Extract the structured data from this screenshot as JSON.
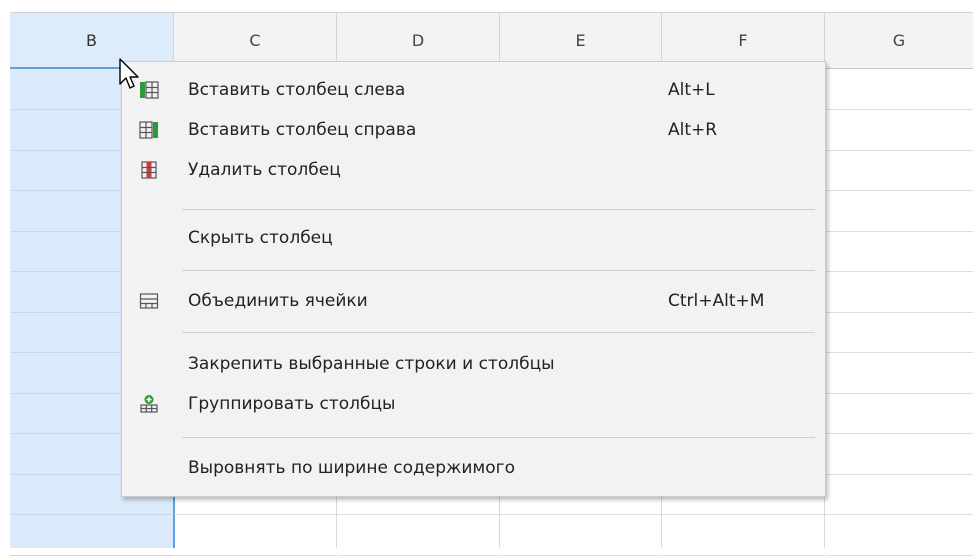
{
  "columns": [
    {
      "letter": "B",
      "selected": true
    },
    {
      "letter": "C",
      "selected": false
    },
    {
      "letter": "D",
      "selected": false
    },
    {
      "letter": "E",
      "selected": false
    },
    {
      "letter": "F",
      "selected": false
    },
    {
      "letter": "G",
      "selected": false
    }
  ],
  "context_menu": {
    "items": [
      {
        "label": "Вставить столбец слева",
        "shortcut": "Alt+L",
        "icon": "insert-column-left-icon"
      },
      {
        "label": "Вставить столбец справа",
        "shortcut": "Alt+R",
        "icon": "insert-column-right-icon"
      },
      {
        "label": "Удалить столбец",
        "shortcut": "",
        "icon": "delete-column-icon"
      },
      {
        "label": "Скрыть столбец",
        "shortcut": "",
        "icon": ""
      },
      {
        "label": "Объединить ячейки",
        "shortcut": "Ctrl+Alt+M",
        "icon": "merge-cells-icon"
      },
      {
        "label": "Закрепить выбранные строки и столбцы",
        "shortcut": "",
        "icon": ""
      },
      {
        "label": "Группировать столбцы",
        "shortcut": "",
        "icon": "group-columns-icon"
      },
      {
        "label": "Выровнять по ширине содержимого",
        "shortcut": "",
        "icon": ""
      }
    ]
  },
  "colors": {
    "selection": "#dbeafa",
    "selection_border": "#5aa0e6",
    "menu_background": "#f2f2f2",
    "icon_green": "#2e9b3a",
    "icon_red": "#d23b3b"
  }
}
